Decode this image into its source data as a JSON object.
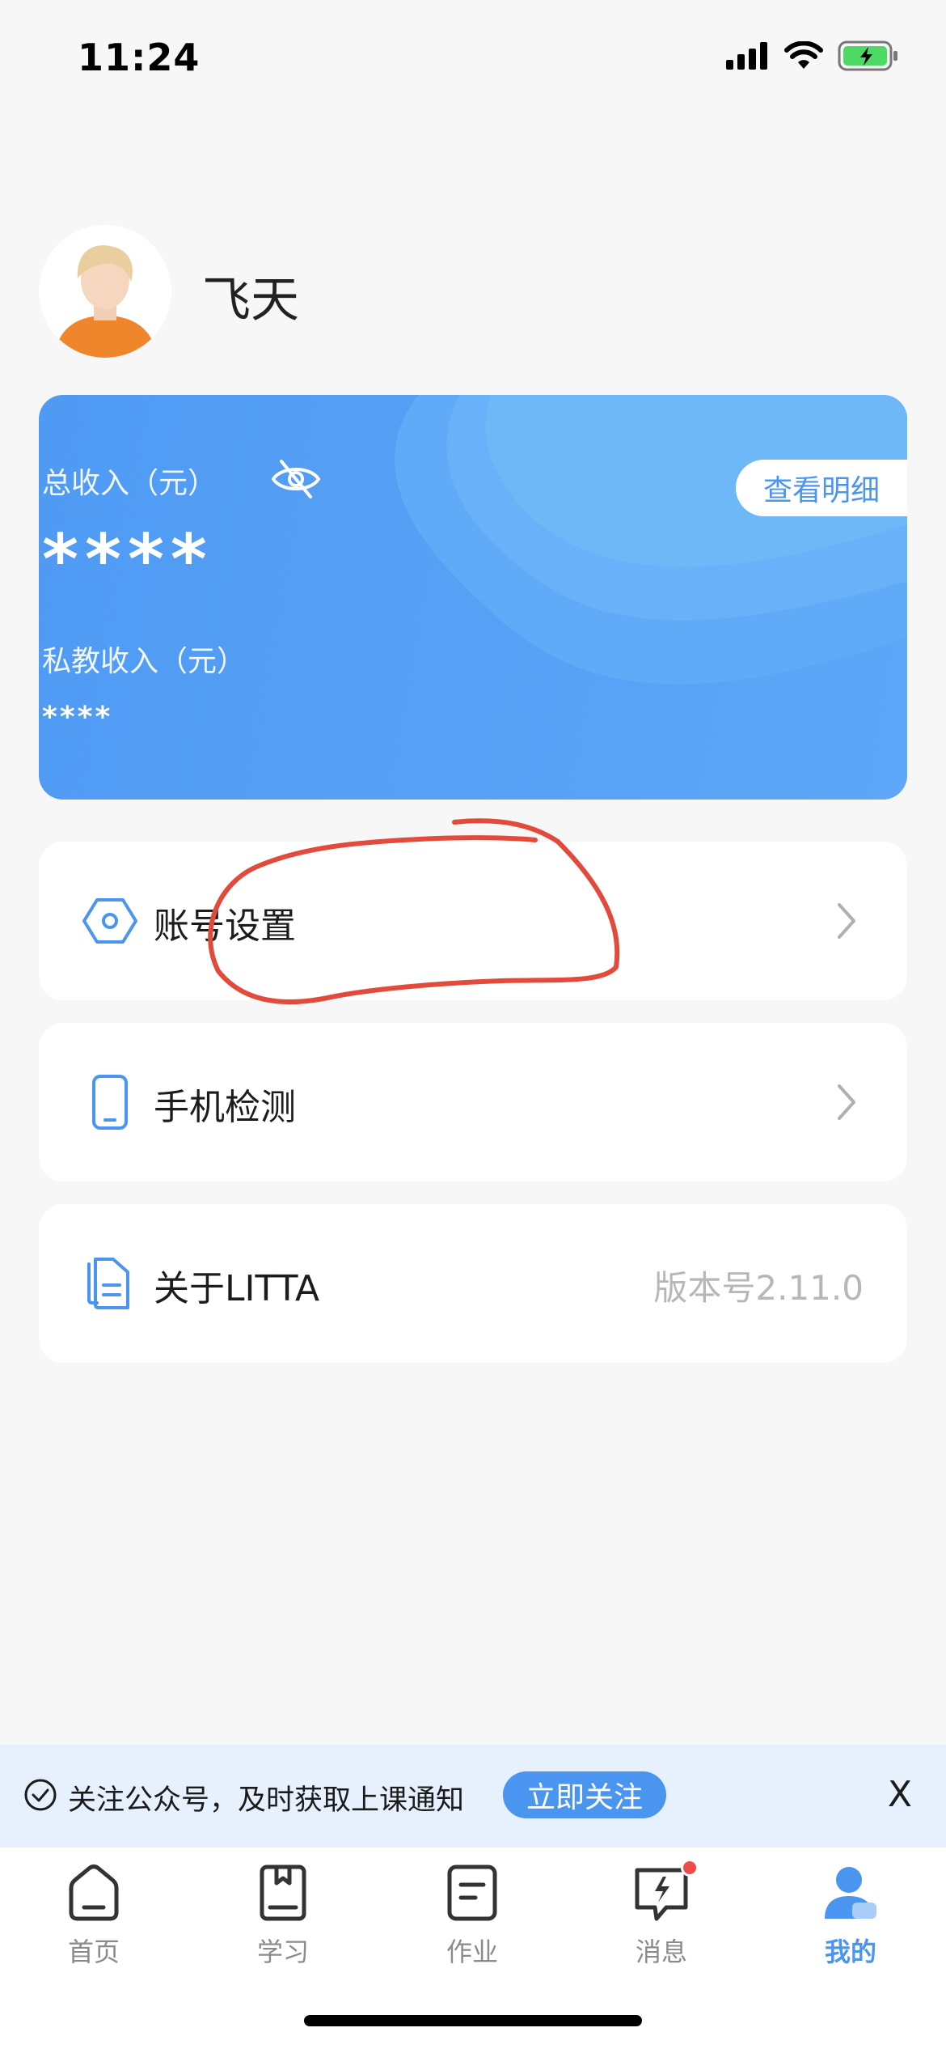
{
  "status_bar": {
    "time": "11:24",
    "icons": [
      "cellular-signal-icon",
      "wifi-icon",
      "battery-charging-icon"
    ]
  },
  "profile": {
    "name": "飞天"
  },
  "income_card": {
    "total_label": "总收入（元）",
    "total_value": "****",
    "private_label": "私教收入（元）",
    "private_value": "****",
    "detail_button": "查看明细",
    "visibility_icon": "eye-off-icon",
    "colors": {
      "card": "#5ea6f7",
      "accent": "#4a95ef"
    }
  },
  "menu": {
    "items": [
      {
        "label": "账号设置",
        "icon": "hexagon-settings-icon"
      },
      {
        "label": "手机检测",
        "icon": "phone-icon"
      },
      {
        "label": "关于LITTA",
        "icon": "documents-icon",
        "value": "版本号2.11.0"
      }
    ]
  },
  "follow_banner": {
    "text": "关注公众号，及时获取上课通知",
    "button": "立即关注",
    "close": "X"
  },
  "tab_bar": {
    "items": [
      {
        "label": "首页",
        "icon": "home-icon"
      },
      {
        "label": "学习",
        "icon": "book-icon"
      },
      {
        "label": "作业",
        "icon": "homework-icon"
      },
      {
        "label": "消息",
        "icon": "message-icon"
      },
      {
        "label": "我的",
        "icon": "profile-icon"
      }
    ],
    "active": "我的",
    "active_color": "#4a95ef"
  }
}
